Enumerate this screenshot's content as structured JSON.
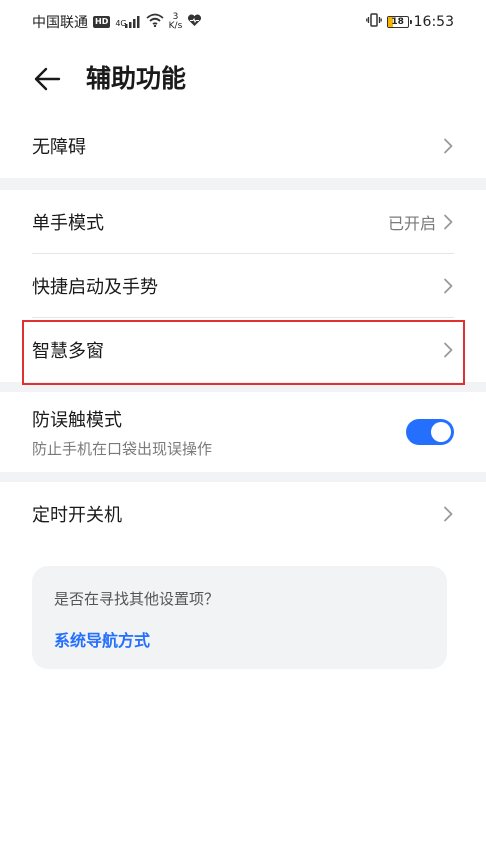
{
  "status_bar": {
    "carrier": "中国联通",
    "hd": "HD",
    "network": "4G",
    "speed_value": "3",
    "speed_unit": "K/s",
    "battery": "18",
    "time": "16:53"
  },
  "header": {
    "title": "辅助功能"
  },
  "groups": {
    "accessibility": {
      "label": "无障碍"
    },
    "one_hand": {
      "label": "单手模式",
      "value": "已开启"
    },
    "shortcuts": {
      "label": "快捷启动及手势"
    },
    "smart_window": {
      "label": "智慧多窗"
    },
    "pocket_mode": {
      "label": "防误触模式",
      "sub": "防止手机在口袋出现误操作",
      "enabled": true
    },
    "scheduled_power": {
      "label": "定时开关机"
    }
  },
  "suggestion": {
    "question": "是否在寻找其他设置项？",
    "link": "系统导航方式"
  },
  "colors": {
    "accent": "#256fff",
    "highlight": "#e03131",
    "gap": "#f1f3f5"
  }
}
